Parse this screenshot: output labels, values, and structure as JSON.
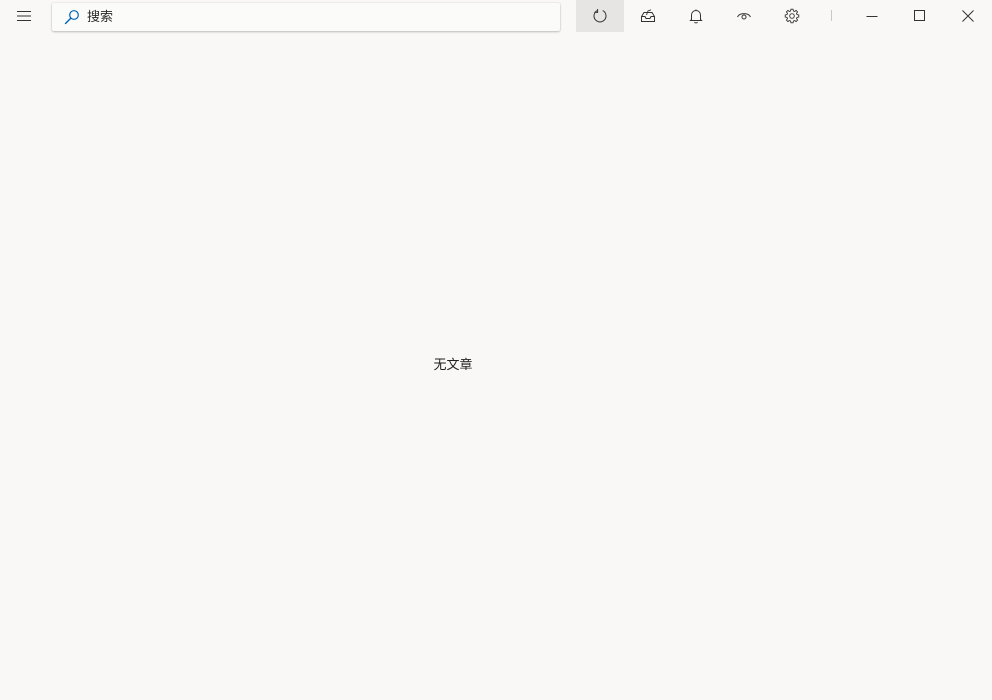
{
  "toolbar": {
    "menu_icon": "hamburger-menu-icon",
    "refresh_icon": "refresh-icon",
    "inbox_icon": "inbox-icon",
    "bell_icon": "bell-icon",
    "eye_icon": "eye-icon",
    "gear_icon": "gear-icon"
  },
  "search": {
    "placeholder": "搜索",
    "value": "",
    "icon": "search-icon",
    "icon_color": "#0063b1"
  },
  "window_controls": {
    "minimize_icon": "minimize-icon",
    "maximize_icon": "maximize-icon",
    "close_icon": "close-icon"
  },
  "main": {
    "empty_text": "无文章"
  },
  "colors": {
    "background": "#f9f8f6",
    "active_button": "#e6e5e3",
    "icon": "#333333"
  }
}
